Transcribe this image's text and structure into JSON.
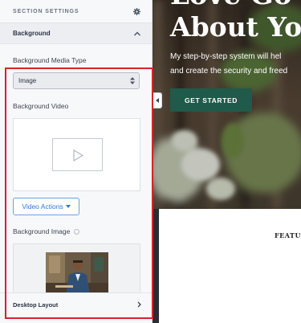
{
  "sidebar": {
    "section_title": "SECTION SETTINGS",
    "background_title": "Background",
    "media_type_label": "Background Media Type",
    "media_type_value": "Image",
    "video_label": "Background Video",
    "video_actions_label": "Video Actions",
    "image_label": "Background Image",
    "desktop_layout_label": "Desktop Layout"
  },
  "preview": {
    "hero_line1": "Love Go",
    "hero_line2": "About Yo",
    "hero_sub_line1": "My step-by-step system will hel",
    "hero_sub_line2": "and create the security and freed",
    "cta_label": "GET STARTED",
    "features_label": "FEATUR"
  },
  "colors": {
    "cta_green": "#1f5a4a",
    "link_blue": "#2b7bd6",
    "highlight_red": "#d8232a"
  }
}
